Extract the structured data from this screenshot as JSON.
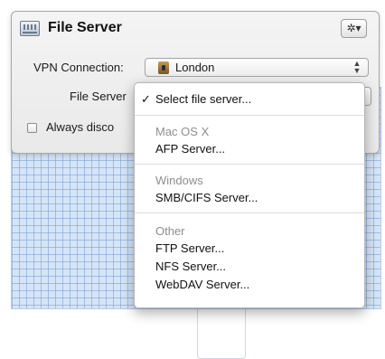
{
  "panel": {
    "title": "File Server",
    "title_icon": "file-server-icon",
    "gear_icon": "gear-icon",
    "gear_glyph": "✲▾"
  },
  "vpn": {
    "label": "VPN Connection:",
    "value": "London",
    "icon": "lock-icon",
    "arrows": "⌃⌄"
  },
  "file_server": {
    "label": "File Server"
  },
  "always_disconnect": {
    "label": "Always disco",
    "checked": false
  },
  "menu": {
    "check_mark": "✓",
    "selected": "Select file server...",
    "groups": [
      {
        "header": "Mac OS X",
        "items": [
          "AFP Server..."
        ]
      },
      {
        "header": "Windows",
        "items": [
          "SMB/CIFS Server..."
        ]
      },
      {
        "header": "Other",
        "items": [
          "FTP Server...",
          "NFS Server...",
          "WebDAV Server..."
        ]
      }
    ]
  }
}
